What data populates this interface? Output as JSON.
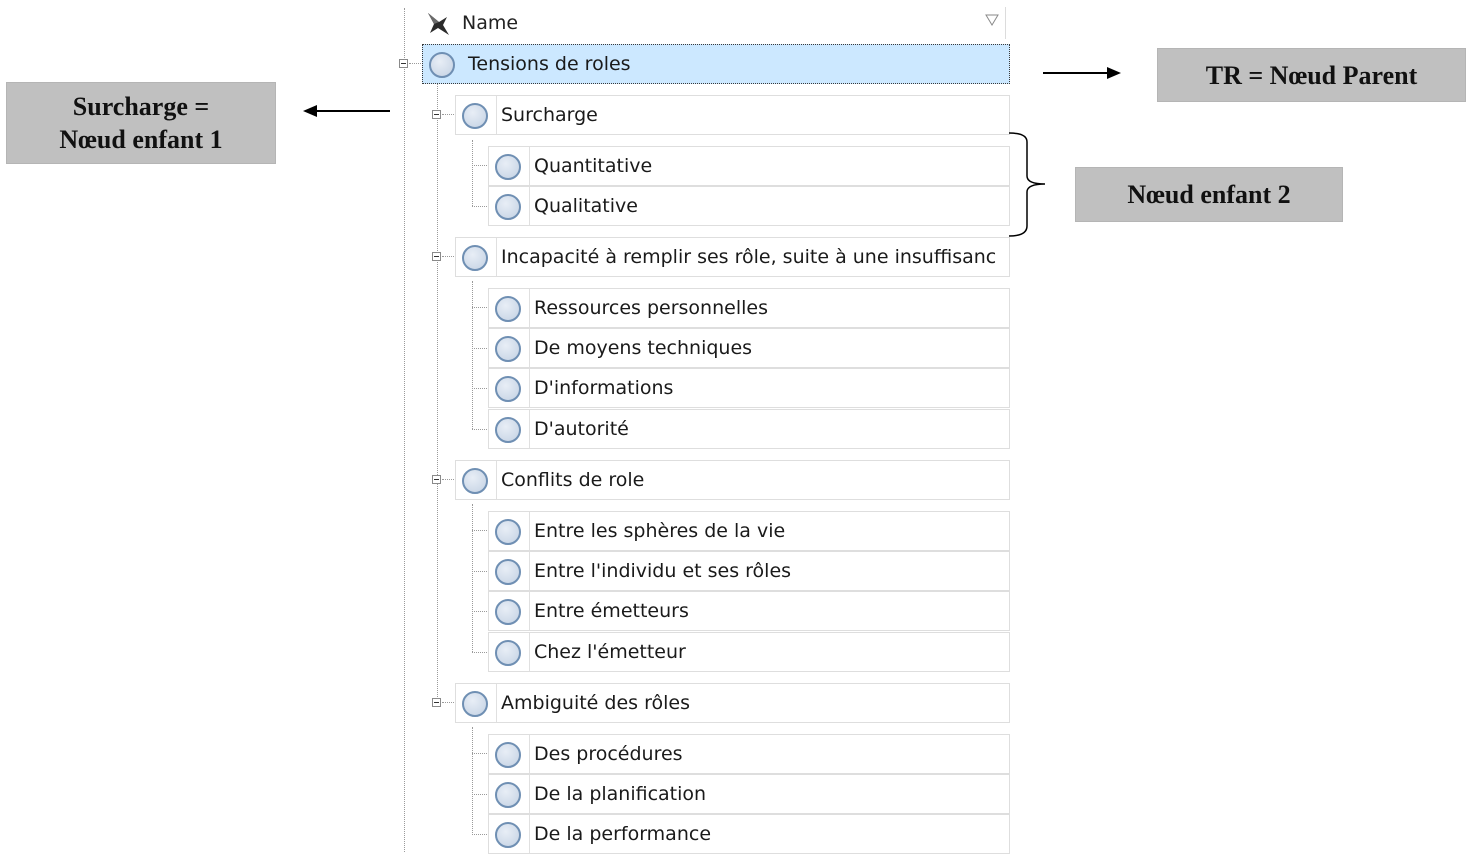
{
  "tree": {
    "header": {
      "label": "Name"
    },
    "root": {
      "label": "Tensions de roles"
    },
    "groups": [
      {
        "label": "Surcharge",
        "children": [
          "Quantitative",
          "Qualitative"
        ]
      },
      {
        "label": "Incapacité à remplir ses rôle, suite à une insuffisanc",
        "children": [
          "Ressources personnelles",
          "De moyens techniques",
          "D'informations",
          "D'autorité"
        ]
      },
      {
        "label": "Conflits de role",
        "children": [
          "Entre les sphères de la vie",
          "Entre l'individu et ses rôles",
          "Entre émetteurs",
          "Chez l'émetteur"
        ]
      },
      {
        "label": "Ambiguité des rôles",
        "children": [
          "Des procédures",
          "De la planification",
          "De la performance"
        ]
      }
    ]
  },
  "callouts": {
    "parent": {
      "text": "TR = Nœud Parent"
    },
    "child1": {
      "line1": "Surcharge =",
      "line2": "Nœud enfant 1"
    },
    "child2": {
      "text": "Nœud enfant 2"
    }
  },
  "colors": {
    "selection_bg": "#cce8ff",
    "node_fill": "#c3d1e3",
    "node_border": "#6f8fb3",
    "callout_bg": "#c0c0c0"
  },
  "icons": {
    "header": "pin-icon",
    "filter": "filter-icon",
    "toggle": "collapse-toggle",
    "node": "node-circle-icon"
  }
}
